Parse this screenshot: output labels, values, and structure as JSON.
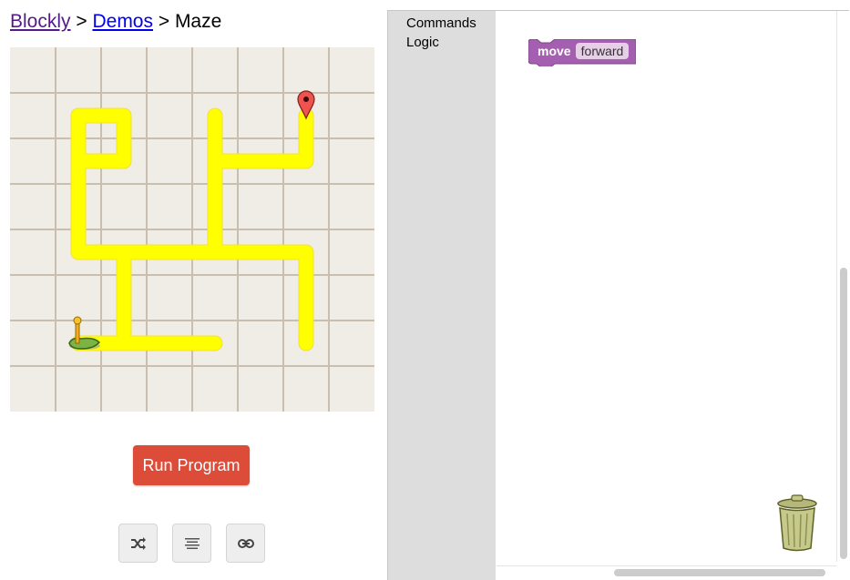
{
  "breadcrumb": {
    "blockly": "Blockly",
    "sep1": " > ",
    "demos": "Demos",
    "sep2": " > ",
    "current": "Maze"
  },
  "maze": {
    "icons": [
      "start-marker-icon",
      "goal-pin-icon"
    ],
    "colors": {
      "background": "#f0ede6",
      "grid": "#c9bfae",
      "path": "#ffff00",
      "pin": "#ef5350"
    }
  },
  "controls": {
    "run_label": "Run Program",
    "icons": [
      "shuffle-icon",
      "format-align-icon",
      "link-icon"
    ]
  },
  "toolbox": {
    "categories": [
      "Commands",
      "Logic"
    ]
  },
  "workspace": {
    "block": {
      "label": "move",
      "dropdown_value": "forward",
      "color": "#a55fb0"
    },
    "icons": [
      "trash-can-icon"
    ]
  }
}
